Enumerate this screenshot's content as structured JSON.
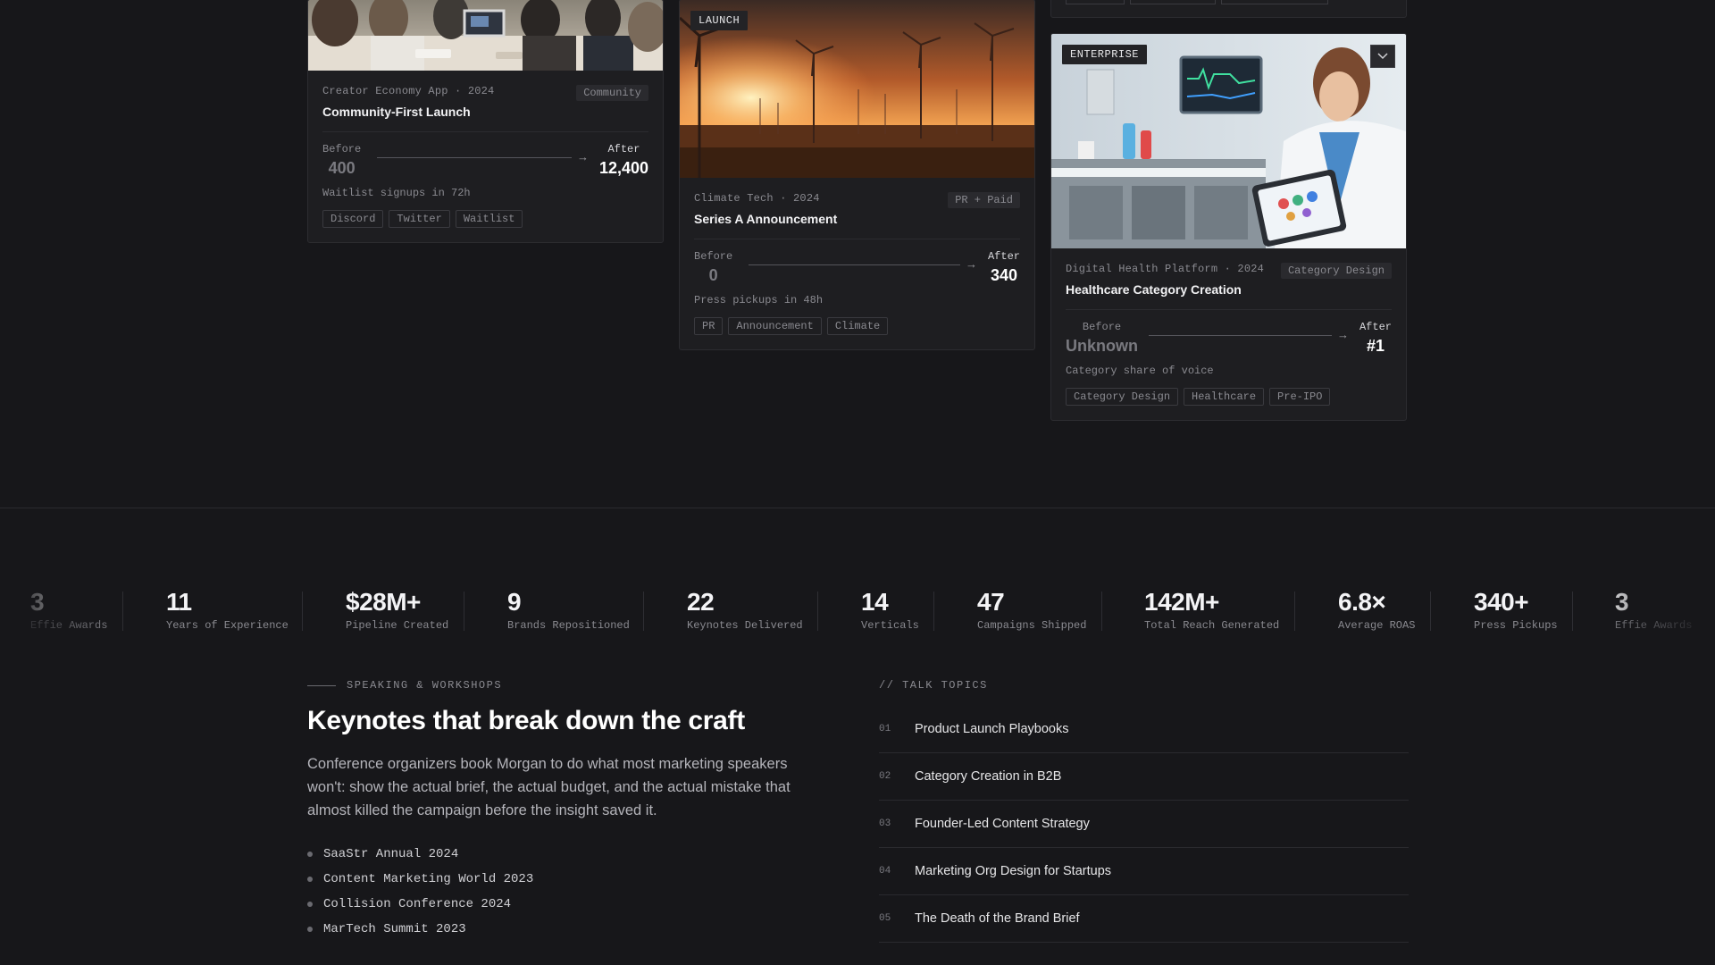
{
  "cards": [
    {
      "meta": "Creator Economy App · 2024",
      "category": "Community",
      "title": "Community-First Launch",
      "before_label": "Before",
      "before_value": "400",
      "after_label": "After",
      "after_value": "12,400",
      "caption": "Waitlist signups in 72h",
      "tags": [
        "Discord",
        "Twitter",
        "Waitlist"
      ]
    },
    {
      "badge": "LAUNCH",
      "meta": "Climate Tech · 2024",
      "category": "PR + Paid",
      "title": "Series A Announcement",
      "before_label": "Before",
      "before_value": "0",
      "after_label": "After",
      "after_value": "340",
      "caption": "Press pickups in 48h",
      "tags": [
        "PR",
        "Announcement",
        "Climate"
      ]
    },
    {
      "badge": "ENTERPRISE",
      "meta": "Digital Health Platform · 2024",
      "category": "Category Design",
      "title": "Healthcare Category Creation",
      "before_label": "Before",
      "before_value": "Unknown",
      "after_label": "After",
      "after_value": "#1",
      "caption": "Category share of voice",
      "tags": [
        "Category Design",
        "Healthcare",
        "Pre-IPO"
      ]
    }
  ],
  "stats": [
    {
      "value": "3",
      "label": "Effie Awards"
    },
    {
      "value": "11",
      "label": "Years of Experience"
    },
    {
      "value": "$28M+",
      "label": "Pipeline Created"
    },
    {
      "value": "9",
      "label": "Brands Repositioned"
    },
    {
      "value": "22",
      "label": "Keynotes Delivered"
    },
    {
      "value": "14",
      "label": "Verticals"
    },
    {
      "value": "47",
      "label": "Campaigns Shipped"
    },
    {
      "value": "142M+",
      "label": "Total Reach Generated"
    },
    {
      "value": "6.8×",
      "label": "Average ROAS"
    },
    {
      "value": "340+",
      "label": "Press Pickups"
    },
    {
      "value": "3",
      "label": "Effie Awards"
    }
  ],
  "speaking": {
    "eyebrow": "SPEAKING & WORKSHOPS",
    "title": "Keynotes that break down the craft",
    "description": "Conference organizers book Morgan to do what most marketing speakers won't: show the actual brief, the actual budget, and the actual mistake that almost killed the campaign before the insight saved it.",
    "events": [
      "SaaStr Annual 2024",
      "Content Marketing World 2023",
      "Collision Conference 2024",
      "MarTech Summit 2023"
    ]
  },
  "topics": {
    "heading": "// TALK TOPICS",
    "items": [
      {
        "num": "01",
        "title": "Product Launch Playbooks"
      },
      {
        "num": "02",
        "title": "Category Creation in B2B"
      },
      {
        "num": "03",
        "title": "Founder-Led Content Strategy"
      },
      {
        "num": "04",
        "title": "Marketing Org Design for Startups"
      },
      {
        "num": "05",
        "title": "The Death of the Brand Brief"
      }
    ]
  },
  "icons": {
    "arrow": "arrow-right-icon",
    "chevron": "chevron-down-icon"
  }
}
